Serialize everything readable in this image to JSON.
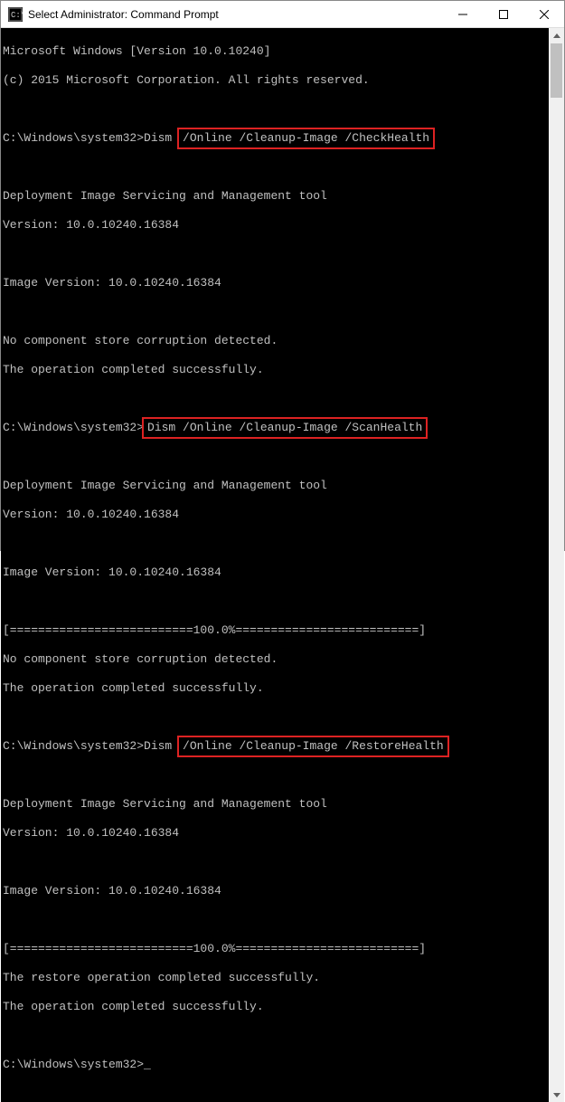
{
  "window": {
    "title": "Select Administrator: Command Prompt"
  },
  "terminal": {
    "lines": {
      "winver": "Microsoft Windows [Version 10.0.10240]",
      "copyright": "(c) 2015 Microsoft Corporation. All rights reserved.",
      "prompt": "C:\\Windows\\system32>",
      "cmd_prefix_dism": "Dism ",
      "cmd1_hl": "/Online /Cleanup-Image /CheckHealth",
      "cmd2_hl": "Dism /Online /Cleanup-Image /ScanHealth",
      "cmd3_hl": "/Online /Cleanup-Image /RestoreHealth",
      "dism_tool": "Deployment Image Servicing and Management tool",
      "dism_ver": "Version: 10.0.10240.16384",
      "image_ver": "Image Version: 10.0.10240.16384",
      "no_corruption": "No component store corruption detected.",
      "op_success": "The operation completed successfully.",
      "progress": "[==========================100.0%==========================]",
      "restore_success": "The restore operation completed successfully.",
      "final_prompt": "C:\\Windows\\system32>",
      "cursor": "_"
    }
  }
}
